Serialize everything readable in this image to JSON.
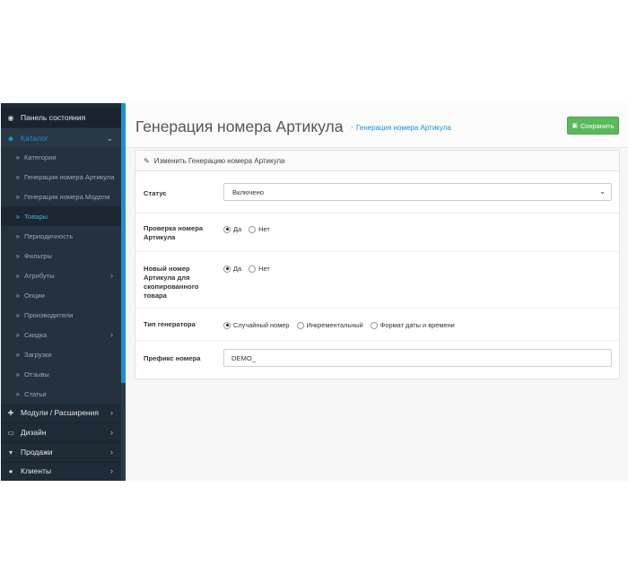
{
  "sidebar": {
    "dashboard": "Панель состояния",
    "catalog": "Каталог",
    "catalog_items": [
      "Категории",
      "Генерация номера Артикула",
      "Генерация номера Модели",
      "Товары",
      "Периодичность",
      "Фильтры",
      "Атрибуты",
      "Опции",
      "Производители",
      "Скидка",
      "Загрузки",
      "Отзывы",
      "Статьи"
    ],
    "modules": "Модули / Расширения",
    "design": "Дизайн",
    "sales": "Продажи",
    "customers": "Клиенты"
  },
  "header": {
    "title": "Генерация номера Артикула",
    "breadcrumb": "Генерация номера Артикула",
    "save_label": "Сохранить"
  },
  "panel": {
    "heading": "Изменить Генерацию номера Артикула",
    "status_label": "Статус",
    "status_value": "Включено",
    "check_label_1": "Проверка номера",
    "check_label_2": "Артикула",
    "new_label_1": "Новый номер",
    "new_label_2": "Артикула для",
    "new_label_3": "скопированного",
    "new_label_4": "товара",
    "yes": "Да",
    "no": "Нет",
    "gen_label": "Тип генератора",
    "gen_opt_1": "Случайный номер",
    "gen_opt_2": "Инкрементальный",
    "gen_opt_3": "Формат даты и времени",
    "prefix_label": "Префикс номера",
    "prefix_value": "DEMO_"
  },
  "colors": {
    "sidebar_bg": "#1f2b36",
    "accent": "#1e91cf",
    "save_green": "#5bb85b"
  }
}
